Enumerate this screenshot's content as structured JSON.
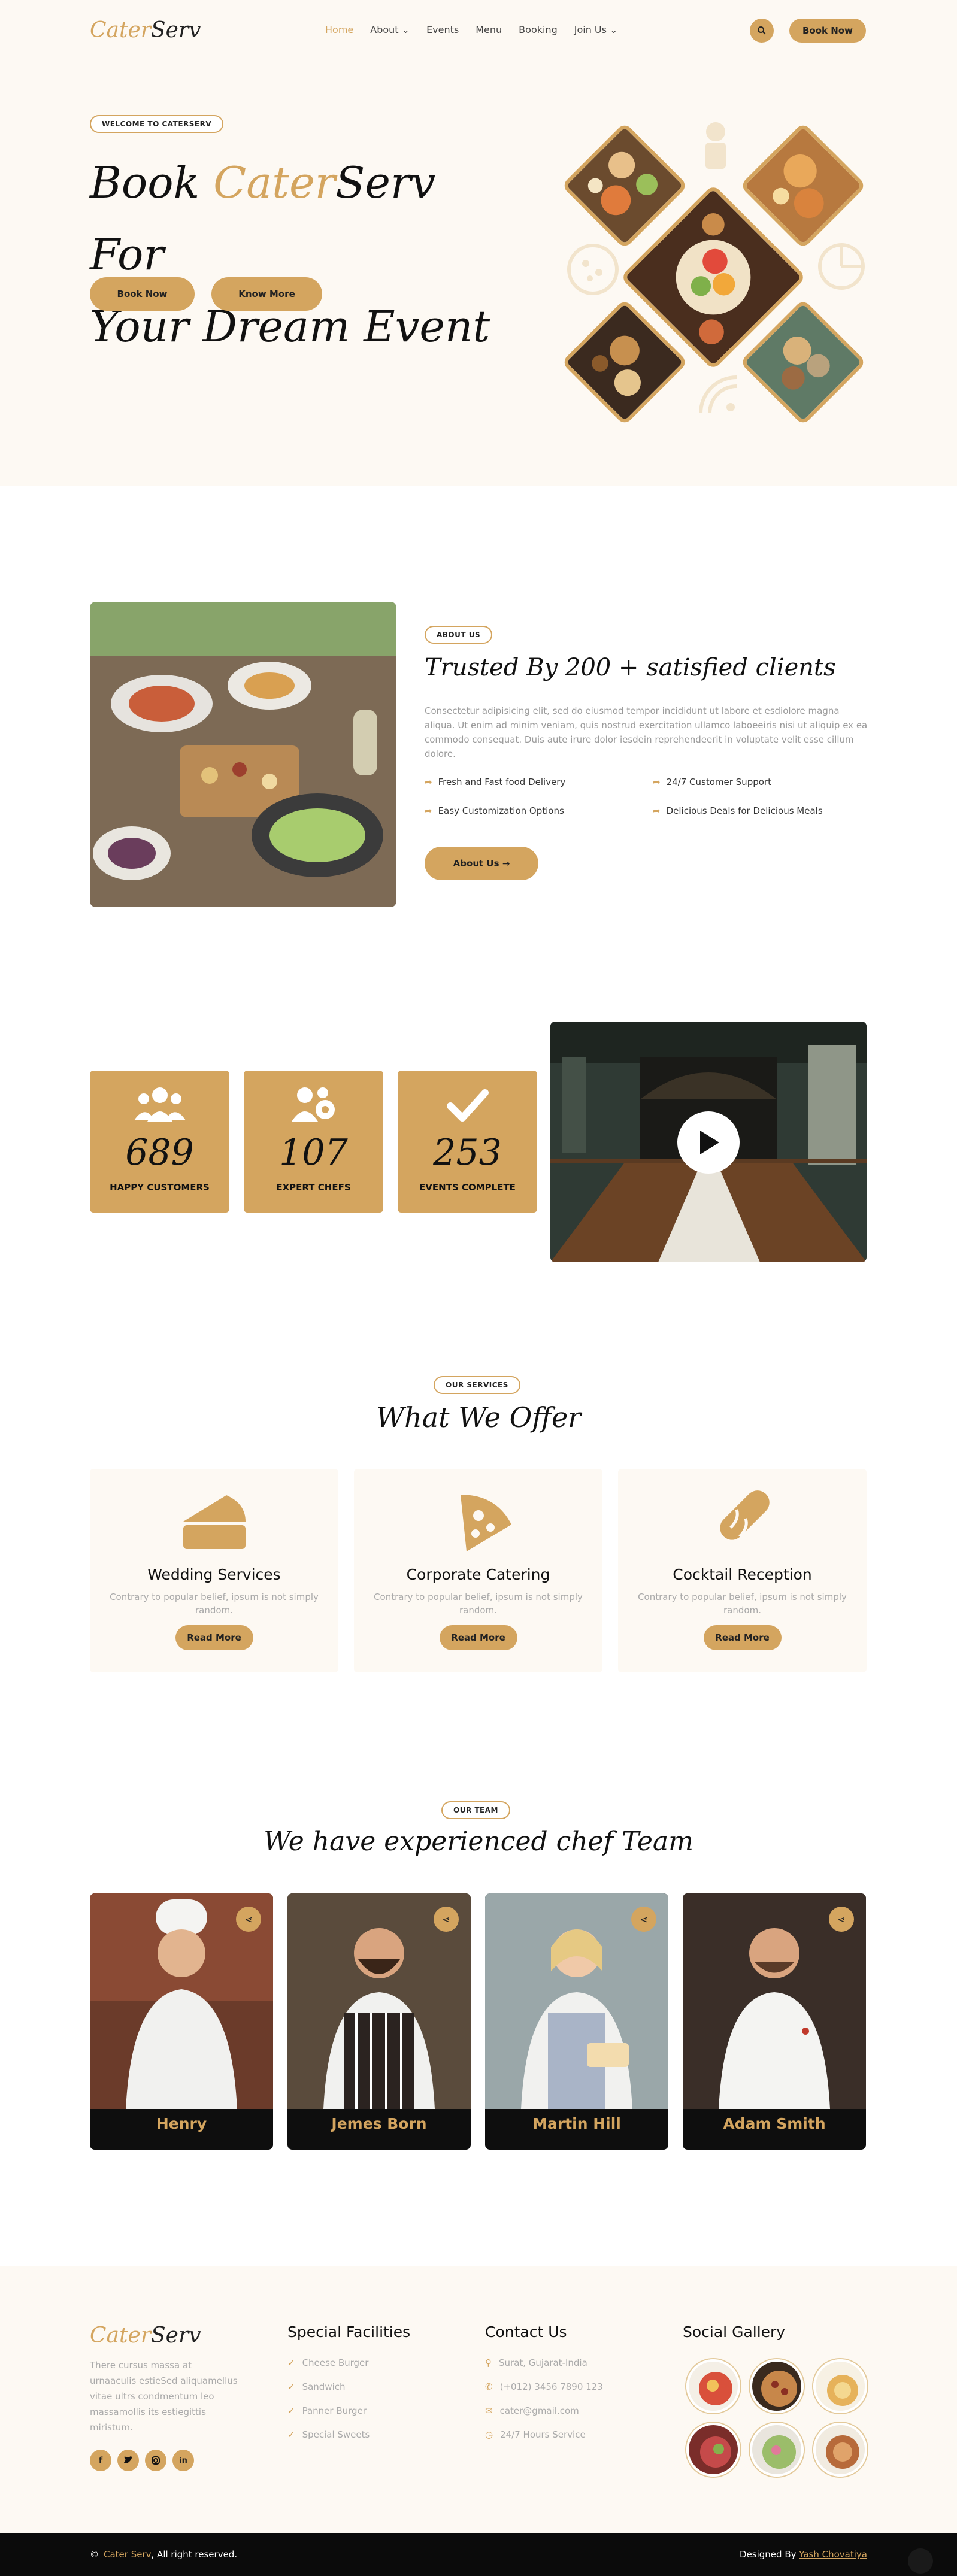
{
  "brand": {
    "logo_part1": "Cater",
    "logo_part2": "Serv"
  },
  "colors": {
    "accent": "#d4a55f",
    "cream": "#fdf9f3",
    "dark": "#0b0b0b"
  },
  "nav": {
    "items": [
      "Home",
      "About",
      "Events",
      "Menu",
      "Booking",
      "Join Us"
    ],
    "active": "Home",
    "book_now": "Book Now"
  },
  "hero": {
    "pill": "WELCOME TO CATERSERV",
    "title_pre": "Book ",
    "title_accent": "Cater",
    "title_post": "Serv For",
    "title_line2": "Your Dream Event",
    "btn_primary": "Book Now",
    "btn_secondary": "Know More"
  },
  "about": {
    "pill": "ABOUT US",
    "title": "Trusted By 200 + satisfied clients",
    "text": "Consectetur adipisicing elit, sed do eiusmod tempor incididunt ut labore et esdiolore magna aliqua. Ut enim ad minim veniam, quis nostrud exercitation ullamco laboeeiris nisi ut aliquip ex ea commodo consequat. Duis aute irure dolor iesdein reprehendeerit in voluptate velit esse cillum dolore.",
    "features": [
      "Fresh and Fast food Delivery",
      "24/7 Customer Support",
      "Easy Customization Options",
      "Delicious Deals for Delicious Meals"
    ],
    "button": "About Us"
  },
  "stats": [
    {
      "number": "689",
      "label": "HAPPY CUSTOMERS",
      "icon": "users-icon"
    },
    {
      "number": "107",
      "label": "EXPERT CHEFS",
      "icon": "users-gear-icon"
    },
    {
      "number": "253",
      "label": "EVENTS COMPLETE",
      "icon": "check-icon"
    }
  ],
  "services": {
    "pill": "OUR SERVICES",
    "title": "What We Offer",
    "items": [
      {
        "title": "Wedding Services",
        "text": "Contrary to popular belief, ipsum is not simply random.",
        "button": "Read More",
        "icon": "cake-icon"
      },
      {
        "title": "Corporate Catering",
        "text": "Contrary to popular belief, ipsum is not simply random.",
        "button": "Read More",
        "icon": "pizza-icon"
      },
      {
        "title": "Cocktail Reception",
        "text": "Contrary to popular belief, ipsum is not simply random.",
        "button": "Read More",
        "icon": "hotdog-icon"
      }
    ]
  },
  "team": {
    "pill": "OUR TEAM",
    "title": "We have experienced chef Team",
    "members": [
      "Henry",
      "Jemes Born",
      "Martin Hill",
      "Adam Smith"
    ]
  },
  "footer": {
    "about": "There cursus massa at urnaaculis estieSed aliquamellus vitae ultrs condmentum leo massamollis its estiegittis miristum.",
    "facilities_title": "Special Facilities",
    "facilities": [
      "Cheese Burger",
      "Sandwich",
      "Panner Burger",
      "Special Sweets"
    ],
    "contact_title": "Contact Us",
    "contact": [
      "Surat, Gujarat-India",
      "(+012) 3456 7890 123",
      "cater@gmail.com",
      "24/7 Hours Service"
    ],
    "gallery_title": "Social Gallery"
  },
  "copyright": {
    "brand": "Cater Serv",
    "text": ", All right reserved.",
    "designed_by": "Designed By ",
    "designer": "Yash Chovatiya"
  }
}
